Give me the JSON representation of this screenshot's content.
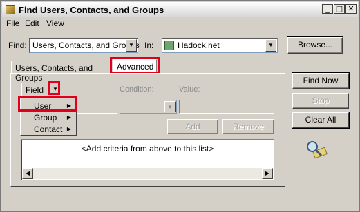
{
  "window": {
    "title": "Find Users, Contacts, and Groups"
  },
  "menu": [
    "File",
    "Edit",
    "View"
  ],
  "find": {
    "label": "Find:",
    "value": "Users, Contacts, and Groups"
  },
  "in": {
    "label": "In:",
    "value": "Hadock.net"
  },
  "browse_label": "Browse...",
  "tabs": [
    {
      "label": "Users, Contacts, and Groups",
      "active": false
    },
    {
      "label": "Advanced",
      "active": true
    }
  ],
  "advanced": {
    "field_label": "Field",
    "condition_label": "Condition:",
    "value_label": "Value:",
    "add_label": "Add",
    "remove_label": "Remove",
    "criteria_hint": "<Add criteria from above to this list>"
  },
  "field_menu": [
    {
      "label": "User",
      "has_submenu": true,
      "highlighted": true
    },
    {
      "label": "Group",
      "has_submenu": true,
      "highlighted": false
    },
    {
      "label": "Contact",
      "has_submenu": true,
      "highlighted": false
    }
  ],
  "actions": {
    "find_now": "Find Now",
    "stop": "Stop",
    "clear_all": "Clear All"
  },
  "highlight_color": "#e0001b"
}
